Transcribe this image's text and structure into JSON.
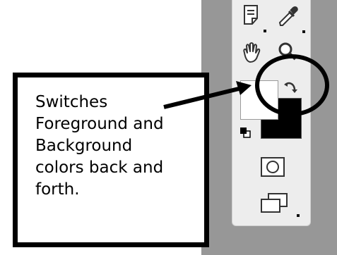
{
  "callout": {
    "text": "Switches\nForeground and\nBackground\ncolors back and\nforth."
  },
  "toolbox": {
    "tools": [
      {
        "name": "notes-icon"
      },
      {
        "name": "eyedropper-icon"
      },
      {
        "name": "hand-icon"
      },
      {
        "name": "zoom-icon"
      },
      {
        "name": "swap-colors-icon"
      },
      {
        "name": "default-colors-icon"
      },
      {
        "name": "quick-mask-icon"
      },
      {
        "name": "screen-mode-icon"
      }
    ],
    "foreground_color": "#ffffff",
    "background_color": "#000000"
  },
  "colors": {
    "panel_gray": "#979797",
    "toolbox_bg": "#ededed",
    "annotation": "#000000"
  }
}
